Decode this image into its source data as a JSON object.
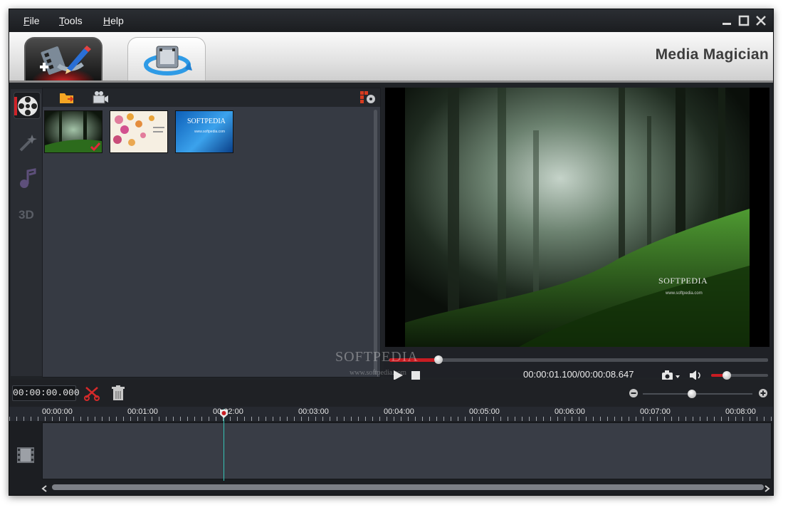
{
  "app": {
    "title": "Media Magician"
  },
  "menu": {
    "file": {
      "mnemonic": "F",
      "rest": "ile"
    },
    "tools": {
      "mnemonic": "T",
      "rest": "ools"
    },
    "help": {
      "mnemonic": "H",
      "rest": "elp"
    }
  },
  "window_controls": [
    "minimize-icon",
    "maximize-icon",
    "close-icon"
  ],
  "tabs": [
    {
      "icon": "film-edit-icon",
      "selected": true
    },
    {
      "icon": "film-convert-icon",
      "selected": false
    }
  ],
  "sidebar": {
    "items": [
      {
        "icon": "film-reel-icon",
        "active": true
      },
      {
        "icon": "magic-wand-icon",
        "active": false
      },
      {
        "icon": "music-note-icon",
        "active": false
      },
      {
        "icon": "3d-icon",
        "active": false
      }
    ]
  },
  "library": {
    "toolbar": [
      "open-folder-icon",
      "capture-video-icon",
      "settings-icon"
    ],
    "thumbnails": [
      {
        "name": "forest",
        "checked": true
      },
      {
        "name": "flowers",
        "checked": false
      },
      {
        "name": "softpedia",
        "checked": false,
        "title": "SOFTPEDIA",
        "url": "www.softpedia.com"
      }
    ]
  },
  "preview": {
    "overlay_text": "SOFTPEDIA",
    "overlay_url": "www.softpedia.com",
    "progress": 0.13,
    "time_display": "00:00:01.100/00:00:08.647",
    "volume": 0.28
  },
  "timeline": {
    "timecode": "00:00:00.000",
    "zoom": 0.45,
    "ruler_labels": [
      "00:00:00",
      "00:01:00",
      "00:02:00",
      "00:03:00",
      "00:04:00",
      "00:05:00",
      "00:06:00",
      "00:07:00",
      "00:08:00"
    ]
  },
  "watermark": {
    "text": "SOFTPEDIA",
    "url": "www.softpedia.com"
  },
  "colors": {
    "accent": "#c81c22",
    "playline": "#35c4b5",
    "panel": "#363a43"
  }
}
